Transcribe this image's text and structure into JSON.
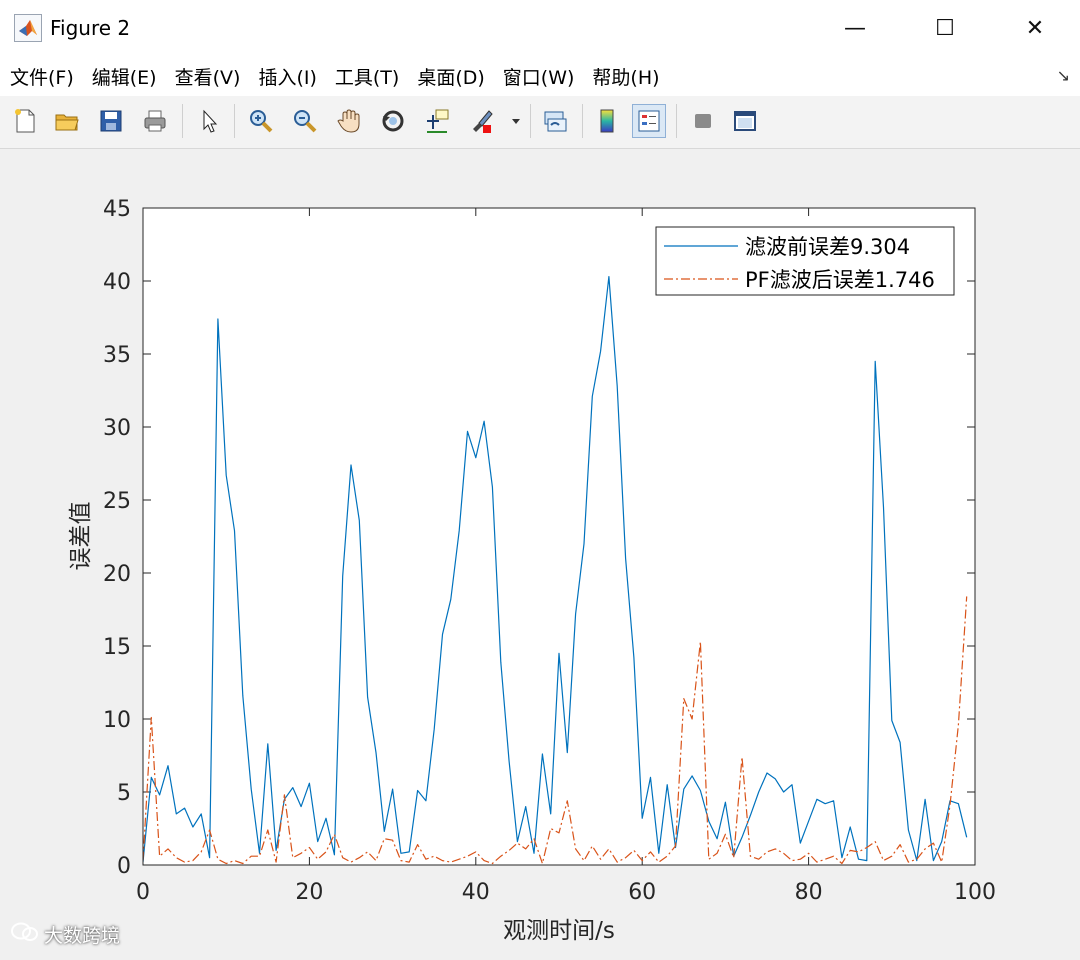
{
  "window": {
    "title": "Figure 2",
    "controls": {
      "minimize": "—",
      "maximize": "☐",
      "close": "✕"
    }
  },
  "menu": {
    "items": [
      "文件(F)",
      "编辑(E)",
      "查看(V)",
      "插入(I)",
      "工具(T)",
      "桌面(D)",
      "窗口(W)",
      "帮助(H)"
    ],
    "corner_icon": "dock-arrow-icon"
  },
  "toolbar": {
    "tools": [
      {
        "name": "new-figure-icon",
        "active": false
      },
      {
        "name": "open-folder-icon",
        "active": false
      },
      {
        "name": "save-icon",
        "active": false
      },
      {
        "name": "print-icon",
        "active": false
      },
      {
        "name": "pointer-icon",
        "active": false
      },
      {
        "name": "zoom-in-icon",
        "active": false
      },
      {
        "name": "zoom-out-icon",
        "active": false
      },
      {
        "name": "pan-hand-icon",
        "active": false
      },
      {
        "name": "rotate-3d-icon",
        "active": false
      },
      {
        "name": "data-cursor-icon",
        "active": false
      },
      {
        "name": "brush-icon",
        "active": false
      },
      {
        "name": "link-plot-icon",
        "active": false
      },
      {
        "name": "colorbar-icon",
        "active": false
      },
      {
        "name": "legend-icon",
        "active": true
      },
      {
        "name": "hide-tools-icon",
        "active": false
      },
      {
        "name": "show-tools-icon",
        "active": false
      }
    ]
  },
  "chart_data": {
    "type": "line",
    "title": "",
    "xlabel": "观测时间/s",
    "ylabel": "误差值",
    "xlim": [
      0,
      100
    ],
    "ylim": [
      0,
      45
    ],
    "xticks": [
      0,
      20,
      40,
      60,
      80,
      100
    ],
    "yticks": [
      0,
      5,
      10,
      15,
      20,
      25,
      30,
      35,
      40,
      45
    ],
    "grid": false,
    "legend_position": "top-right",
    "series": [
      {
        "name": "滤波前误差9.304",
        "color": "#0072BD",
        "style": "solid",
        "x": [
          0,
          1,
          2,
          3,
          4,
          5,
          6,
          7,
          8,
          9,
          10,
          11,
          12,
          13,
          14,
          15,
          16,
          17,
          18,
          19,
          20,
          21,
          22,
          23,
          24,
          25,
          26,
          27,
          28,
          29,
          30,
          31,
          32,
          33,
          34,
          35,
          36,
          37,
          38,
          39,
          40,
          41,
          42,
          43,
          44,
          45,
          46,
          47,
          48,
          49,
          50,
          51,
          52,
          53,
          54,
          55,
          56,
          57,
          58,
          59,
          60,
          61,
          62,
          63,
          64,
          65,
          66,
          67,
          68,
          69,
          70,
          71,
          72,
          73,
          74,
          75,
          76,
          77,
          78,
          79,
          80,
          81,
          82,
          83,
          84,
          85,
          86,
          87,
          88,
          89,
          90,
          91,
          92,
          93,
          94,
          95,
          96,
          97,
          98,
          99
        ],
        "y": [
          0.2,
          6.0,
          4.8,
          6.8,
          3.5,
          3.9,
          2.6,
          3.5,
          0.5,
          37.4,
          26.7,
          22.9,
          11.6,
          5.2,
          0.8,
          8.3,
          1.0,
          4.5,
          5.3,
          4.0,
          5.6,
          1.6,
          3.2,
          0.7,
          19.8,
          27.4,
          23.6,
          11.5,
          7.7,
          2.3,
          5.2,
          0.8,
          0.9,
          5.1,
          4.4,
          9.3,
          15.8,
          18.2,
          22.9,
          29.7,
          27.9,
          30.4,
          25.9,
          13.9,
          7.1,
          1.6,
          4.0,
          0.8,
          7.6,
          3.5,
          14.5,
          7.7,
          17.2,
          22.0,
          32.1,
          35.2,
          40.3,
          32.8,
          21.0,
          14.2,
          3.2,
          6.0,
          0.8,
          5.5,
          1.2,
          5.2,
          6.1,
          5.1,
          3.0,
          1.8,
          4.3,
          0.6,
          1.9,
          3.4,
          5.0,
          6.3,
          5.9,
          5.0,
          5.5,
          1.5,
          3.0,
          4.5,
          4.2,
          4.4,
          0.5,
          2.6,
          0.4,
          0.3,
          34.5,
          24.5,
          9.9,
          8.4,
          2.4,
          0.3,
          4.5,
          0.3,
          1.6,
          4.4,
          4.2,
          1.9
        ]
      },
      {
        "name": "PF滤波后误差1.746",
        "color": "#D95319",
        "style": "dashdot",
        "x": [
          0,
          1,
          2,
          3,
          4,
          5,
          6,
          7,
          8,
          9,
          10,
          11,
          12,
          13,
          14,
          15,
          16,
          17,
          18,
          19,
          20,
          21,
          22,
          23,
          24,
          25,
          26,
          27,
          28,
          29,
          30,
          31,
          32,
          33,
          34,
          35,
          36,
          37,
          38,
          39,
          40,
          41,
          42,
          43,
          44,
          45,
          46,
          47,
          48,
          49,
          50,
          51,
          52,
          53,
          54,
          55,
          56,
          57,
          58,
          59,
          60,
          61,
          62,
          63,
          64,
          65,
          66,
          67,
          68,
          69,
          70,
          71,
          72,
          73,
          74,
          75,
          76,
          77,
          78,
          79,
          80,
          81,
          82,
          83,
          84,
          85,
          86,
          87,
          88,
          89,
          90,
          91,
          92,
          93,
          94,
          95,
          96,
          97,
          98,
          99
        ],
        "y": [
          0.3,
          10.1,
          0.6,
          1.1,
          0.5,
          0.2,
          0.3,
          0.9,
          2.4,
          0.4,
          0.1,
          0.3,
          0.1,
          0.6,
          0.6,
          2.4,
          0.2,
          4.8,
          0.5,
          0.8,
          1.2,
          0.4,
          0.9,
          2.1,
          0.5,
          0.2,
          0.5,
          0.9,
          0.3,
          1.8,
          1.7,
          0.3,
          0.2,
          1.4,
          0.4,
          0.6,
          0.3,
          0.2,
          0.4,
          0.6,
          0.9,
          0.3,
          0.1,
          0.6,
          1.0,
          1.5,
          1.1,
          1.8,
          0.1,
          2.5,
          2.2,
          4.4,
          1.1,
          0.3,
          1.3,
          0.4,
          1.1,
          0.2,
          0.5,
          1.0,
          0.3,
          0.9,
          0.2,
          0.6,
          1.3,
          11.4,
          10.0,
          15.3,
          0.4,
          0.8,
          2.1,
          0.5,
          7.4,
          0.6,
          0.4,
          0.9,
          1.1,
          0.8,
          0.3,
          0.4,
          0.8,
          0.2,
          0.4,
          0.6,
          0.1,
          1.0,
          0.9,
          1.2,
          1.6,
          0.3,
          0.6,
          1.4,
          0.2,
          0.4,
          1.1,
          1.5,
          0.2,
          4.1,
          9.6,
          18.4
        ]
      }
    ]
  },
  "watermark": {
    "text": "大数跨境",
    "icon": "wechat-logo-icon"
  }
}
